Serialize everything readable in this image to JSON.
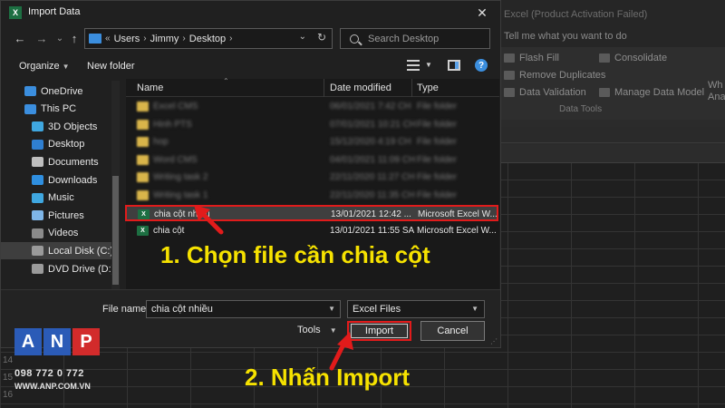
{
  "excel": {
    "title": "Excel (Product Activation Failed)",
    "tell_me": "Tell me what you want to do",
    "commands": [
      "Flash Fill",
      "Consolidate",
      "Remove Duplicates",
      "Data Validation",
      "Manage Data Model"
    ],
    "partial": [
      "Wh",
      "Ana"
    ],
    "group_label": "Data Tools",
    "row_numbers": [
      "14",
      "15",
      "16"
    ]
  },
  "dialog": {
    "title": "Import Data",
    "close_glyph": "✕",
    "nav": {
      "back": "←",
      "forward": "→",
      "history": "⌄",
      "up": "↑"
    },
    "breadcrumb": [
      "Users",
      "Jimmy",
      "Desktop"
    ],
    "search_placeholder": "Search Desktop",
    "toolbar": {
      "organize": "Organize",
      "new_folder": "New folder",
      "help": "?"
    },
    "nav_pane": [
      {
        "label": "OneDrive",
        "icon": "cloud-icon",
        "color": "#3b8ede",
        "indent": 0
      },
      {
        "label": "This PC",
        "icon": "pc-icon",
        "color": "#3b8ede",
        "indent": 0
      },
      {
        "label": "3D Objects",
        "icon": "cube-icon",
        "color": "#3fa7e0",
        "indent": 1
      },
      {
        "label": "Desktop",
        "icon": "desktop-icon",
        "color": "#2f7fd1",
        "indent": 1
      },
      {
        "label": "Documents",
        "icon": "documents-icon",
        "color": "#bfbfbf",
        "indent": 1
      },
      {
        "label": "Downloads",
        "icon": "download-icon",
        "color": "#2f8fe0",
        "indent": 1
      },
      {
        "label": "Music",
        "icon": "music-icon",
        "color": "#3fa7e0",
        "indent": 1
      },
      {
        "label": "Pictures",
        "icon": "pictures-icon",
        "color": "#7fb6e8",
        "indent": 1
      },
      {
        "label": "Videos",
        "icon": "videos-icon",
        "color": "#8a8a8a",
        "indent": 1
      },
      {
        "label": "Local Disk (C:)",
        "icon": "disk-icon",
        "color": "#9a9a9a",
        "indent": 1,
        "selected": true
      },
      {
        "label": "DVD Drive (D:) O",
        "icon": "dvd-icon",
        "color": "#9a9a9a",
        "indent": 1
      }
    ],
    "columns": {
      "name": "Name",
      "date": "Date modified",
      "type": "Type"
    },
    "files": [
      {
        "name": "Excel CMS",
        "date": "06/01/2021 7:42 CH",
        "type": "File folder",
        "kind": "folder"
      },
      {
        "name": "Hinh PTS",
        "date": "07/01/2021 10:21 CH",
        "type": "File folder",
        "kind": "folder"
      },
      {
        "name": "hop",
        "date": "15/12/2020 4:19 CH",
        "type": "File folder",
        "kind": "folder"
      },
      {
        "name": "Word CMS",
        "date": "04/01/2021 11:09 CH",
        "type": "File folder",
        "kind": "folder"
      },
      {
        "name": "Writing task 2",
        "date": "22/11/2020 11:27 CH",
        "type": "File folder",
        "kind": "folder"
      },
      {
        "name": "Writing task 1",
        "date": "22/11/2020 11:35 CH",
        "type": "File folder",
        "kind": "folder"
      },
      {
        "name": "chia cột nhiều",
        "date": "13/01/2021 12:42 ...",
        "type": "Microsoft Excel W...",
        "kind": "xlsx",
        "selected": true
      },
      {
        "name": "chia cột",
        "date": "13/01/2021 11:55 SA",
        "type": "Microsoft Excel W...",
        "kind": "xlsx"
      }
    ],
    "file_name_label": "File name:",
    "file_name_value": "chia cột nhiều",
    "file_type": "Excel Files",
    "tools": "Tools",
    "import": "Import",
    "cancel": "Cancel"
  },
  "annotations": {
    "step1": "1. Chọn file cần chia cột",
    "step2": "2. Nhấn Import",
    "arrow_color": "#e11b1b",
    "text_color": "#f6e200"
  },
  "logo": {
    "letters": [
      "A",
      "N",
      "P"
    ],
    "phone": "098 772 0 772",
    "website": "WWW.ANP.COM.VN"
  }
}
